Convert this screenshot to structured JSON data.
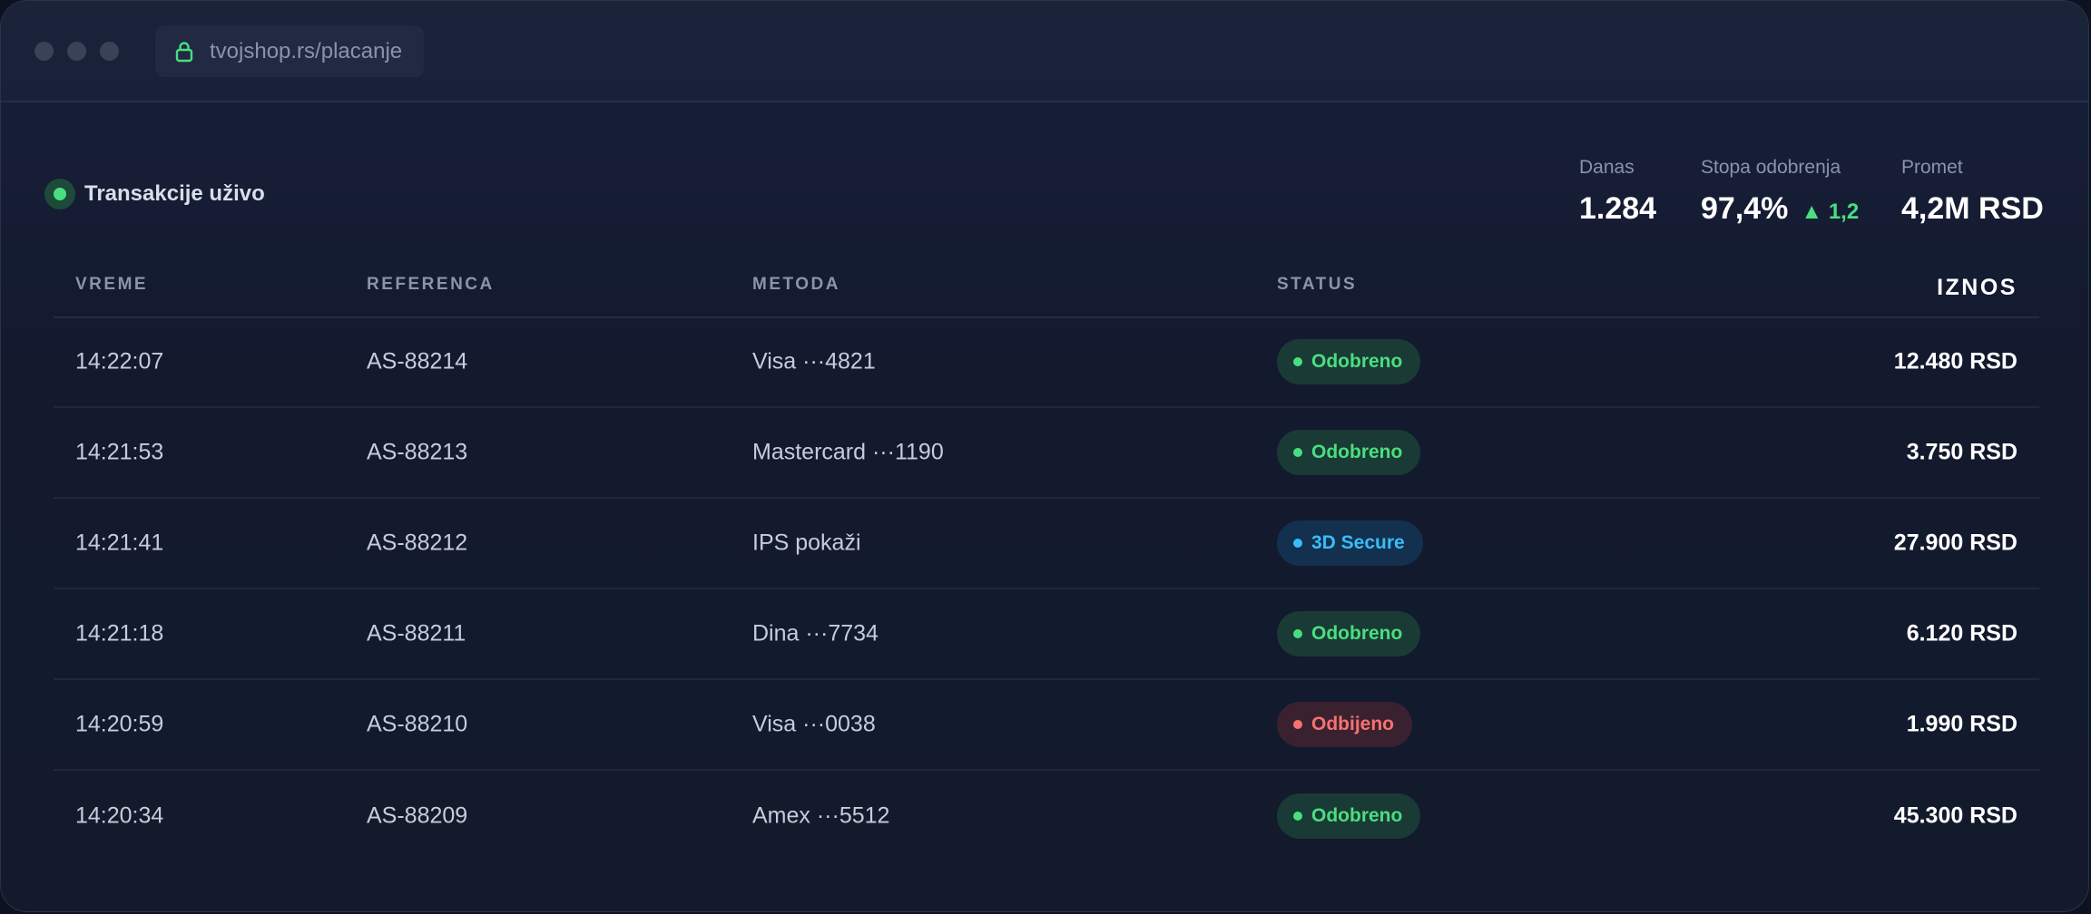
{
  "browser": {
    "url": "tvojshop.rs/placanje"
  },
  "header": {
    "live_label": "Transakcije uživo",
    "stats": [
      {
        "label": "Danas",
        "value": "1.284"
      },
      {
        "label": "Stopa odobrenja",
        "value": "97,4%",
        "delta": "▲ 1,2"
      },
      {
        "label": "Promet",
        "value": "4,2M RSD"
      }
    ]
  },
  "table": {
    "columns": [
      "VREME",
      "REFERENCA",
      "METODA",
      "STATUS",
      "IZNOS"
    ],
    "rows": [
      {
        "time": "14:22:07",
        "ref": "AS-88214",
        "method": "Visa ···4821",
        "status": "Odobreno",
        "status_type": "ok",
        "amount": "12.480 RSD"
      },
      {
        "time": "14:21:53",
        "ref": "AS-88213",
        "method": "Mastercard ···1190",
        "status": "Odobreno",
        "status_type": "ok",
        "amount": "3.750 RSD"
      },
      {
        "time": "14:21:41",
        "ref": "AS-88212",
        "method": "IPS pokaži",
        "status": "3D Secure",
        "status_type": "sec",
        "amount": "27.900 RSD"
      },
      {
        "time": "14:21:18",
        "ref": "AS-88211",
        "method": "Dina ···7734",
        "status": "Odobreno",
        "status_type": "ok",
        "amount": "6.120 RSD"
      },
      {
        "time": "14:20:59",
        "ref": "AS-88210",
        "method": "Visa ···0038",
        "status": "Odbijeno",
        "status_type": "bad",
        "amount": "1.990 RSD"
      },
      {
        "time": "14:20:34",
        "ref": "AS-88209",
        "method": "Amex ···5512",
        "status": "Odobreno",
        "status_type": "ok",
        "amount": "45.300 RSD"
      }
    ]
  },
  "colors": {
    "approved": "#4ade80",
    "secure": "#38bdf8",
    "declined": "#f87171",
    "background": "#131a2e"
  }
}
